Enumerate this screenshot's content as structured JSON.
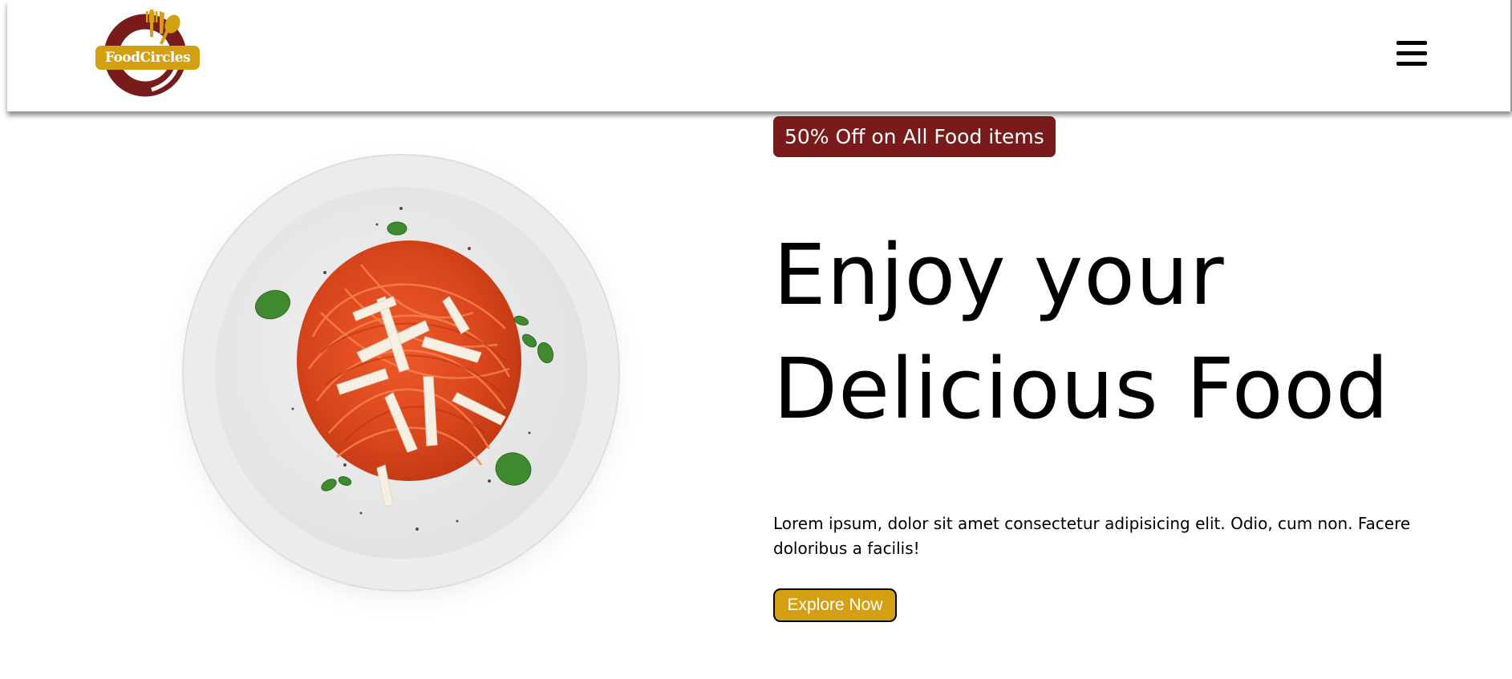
{
  "header": {
    "logo_text": "FoodCircles",
    "menu_icon": "hamburger-menu-icon"
  },
  "hero": {
    "badge": "50% Off on All Food items",
    "title_line1": "Enjoy your",
    "title_line2": "Delicious Food",
    "description": "Lorem ipsum, dolor sit amet consectetur adipisicing elit. Odio, cum non. Facere doloribus a facilis!",
    "button_label": "Explore Now",
    "image_subject": "spaghetti-plate-image"
  },
  "colors": {
    "brand_maroon": "#7a1b1b",
    "brand_gold": "#d4a011",
    "text": "#000000",
    "background": "#ffffff"
  }
}
